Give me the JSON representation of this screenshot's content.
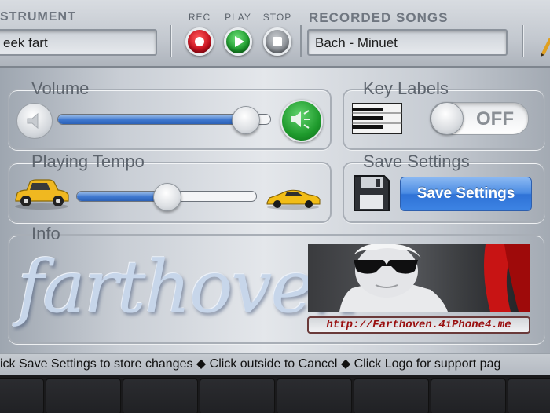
{
  "header": {
    "instrument_label": "STRUMENT",
    "instrument_value": "eek fart",
    "rec_label": "REC",
    "play_label": "PLAY",
    "stop_label": "STOP",
    "songs_label": "RECORDED SONGS",
    "song_value": "Bach - Minuet"
  },
  "volume": {
    "label": "Volume",
    "level": 0.88
  },
  "key_labels": {
    "label": "Key Labels",
    "toggle_text": "OFF",
    "state": "off"
  },
  "tempo": {
    "label": "Playing Tempo",
    "level": 0.5
  },
  "save_settings": {
    "label": "Save Settings",
    "button_label": "Save Settings"
  },
  "info": {
    "label": "Info",
    "logo_text": "farthoven",
    "url": "http://Farthoven.4iPhone4.me"
  },
  "status_bar": {
    "text": "ick Save Settings to store changes ◆ Click outside to Cancel ◆ Click Logo for support pag"
  },
  "colors": {
    "accent": "#3f7fde",
    "rec": "#c8101e",
    "play": "#1c9a2c",
    "url_text": "#9a1010"
  },
  "icons": [
    "speaker-muted-icon",
    "speaker-loud-icon",
    "slow-car-icon",
    "fast-car-icon",
    "piano-keys-icon",
    "floppy-disk-icon",
    "pencil-icon"
  ]
}
